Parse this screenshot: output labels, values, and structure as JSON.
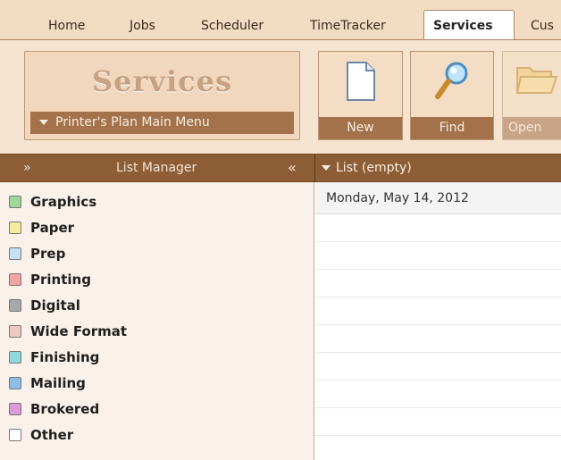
{
  "tabs": [
    "Home",
    "Jobs",
    "Scheduler",
    "TimeTracker",
    "Services",
    "Cus"
  ],
  "active_tab": "Services",
  "ribbon": {
    "group_title": "Services",
    "menu_dropdown": "Printer's Plan Main Menu",
    "buttons": {
      "new": "New",
      "find": "Find",
      "open": "Open"
    }
  },
  "list_manager": {
    "title": "List Manager",
    "collapse_glyph": "«",
    "expand_glyph": "»"
  },
  "list_header": "List (empty)",
  "date_header": "Monday, May 14, 2012",
  "categories": [
    {
      "label": "Graphics",
      "color": "#9fd79a"
    },
    {
      "label": "Paper",
      "color": "#f4ec9c"
    },
    {
      "label": "Prep",
      "color": "#c9e0f3"
    },
    {
      "label": "Printing",
      "color": "#f3a3a3"
    },
    {
      "label": "Digital",
      "color": "#a8a8a8"
    },
    {
      "label": "Wide Format",
      "color": "#efc9c4"
    },
    {
      "label": "Finishing",
      "color": "#8fd9de"
    },
    {
      "label": "Mailing",
      "color": "#8dbde8"
    },
    {
      "label": "Brokered",
      "color": "#d99ad7"
    },
    {
      "label": "Other",
      "color": "#ffffff"
    }
  ]
}
